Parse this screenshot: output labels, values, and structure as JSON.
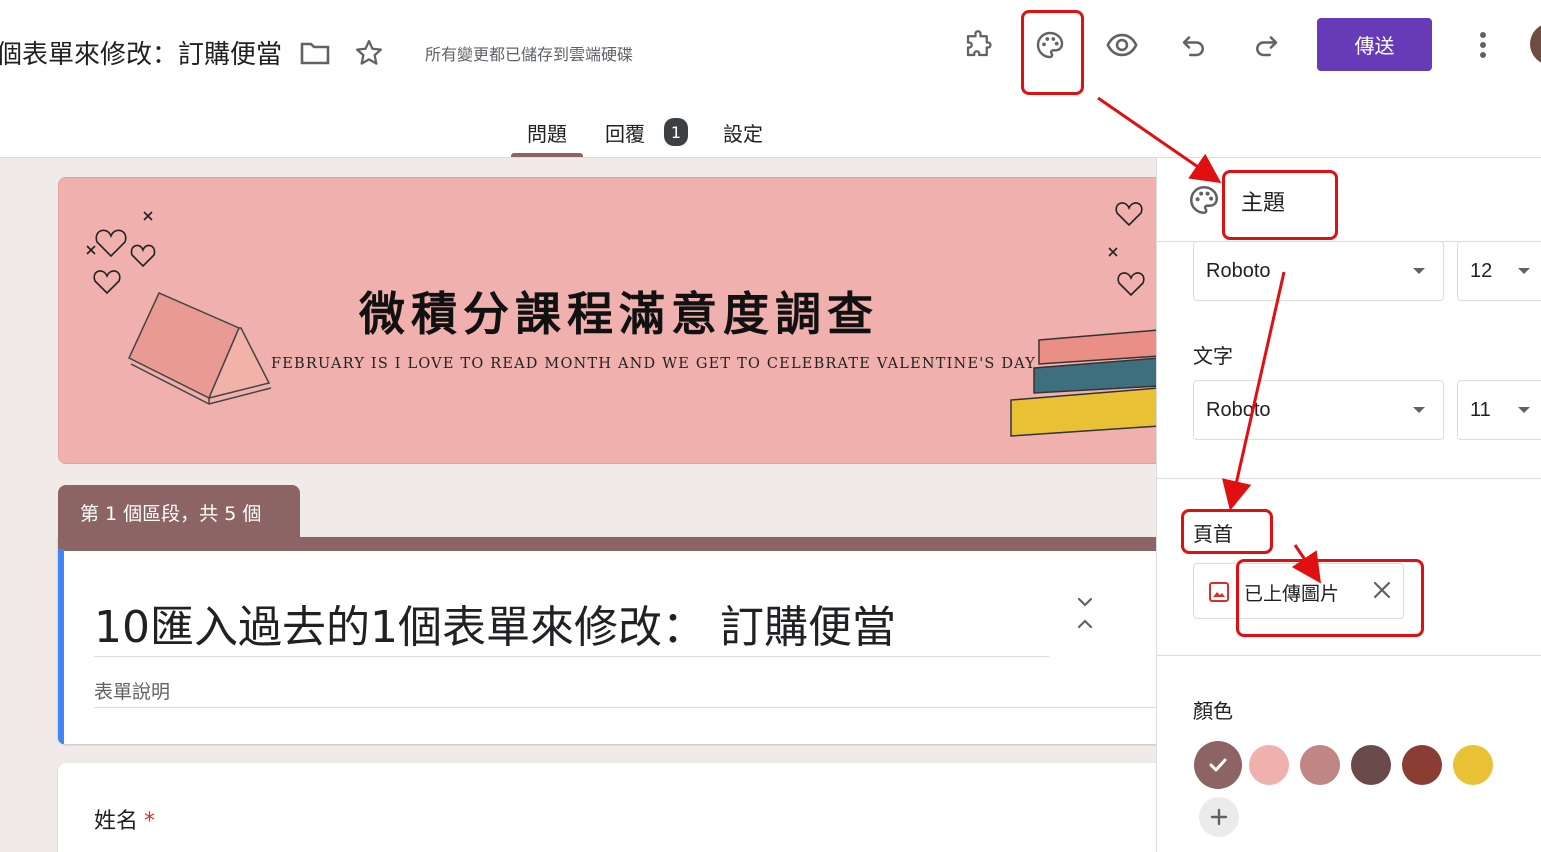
{
  "topbar": {
    "doc_title": "個表單來修改：訂購便當",
    "save_status": "所有變更都已儲存到雲端硬碟",
    "send_label": "傳送",
    "icons": [
      "folder-icon",
      "star-icon",
      "puzzle-icon",
      "palette-icon",
      "eye-icon",
      "undo-icon",
      "redo-icon",
      "more-vert-icon"
    ]
  },
  "tabs": {
    "questions": "問題",
    "responses": "回覆",
    "responses_count": "1",
    "settings": "設定"
  },
  "header_image": {
    "title": "微積分課程滿意度調查",
    "subtitle": "FEBRUARY IS I LOVE TO READ MONTH AND WE GET TO CELEBRATE VALENTINE'S DAY"
  },
  "section": {
    "tab_label": "第 1 個區段，共 5 個"
  },
  "form": {
    "title": "10匯入過去的1個表單來修改：  訂購便當",
    "description_placeholder": "表單說明"
  },
  "question": {
    "label": "姓名",
    "required_mark": "*"
  },
  "theme_panel": {
    "title": "主題",
    "header_font": "Roboto",
    "header_size": "12",
    "text_label": "文字",
    "text_font": "Roboto",
    "text_size": "11",
    "header_image_label": "頁首",
    "uploaded_chip": "已上傳圖片",
    "color_label": "顏色",
    "colors": [
      "#8d6464",
      "#efb0ae",
      "#c08683",
      "#6a4a4a",
      "#8a3d33",
      "#e8c234"
    ],
    "selected_color": "#8d6464"
  },
  "annotation_color": "#e01010"
}
